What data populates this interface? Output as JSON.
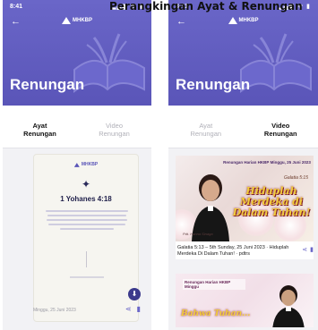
{
  "caption": "Perangkingan Ayat & Renungan",
  "screens": {
    "left": {
      "status": {
        "time": "8:41",
        "icons": "▂▄▆ ᯤ ▮"
      },
      "logo": "MHKBP",
      "title": "Renungan",
      "tabs": [
        "Ayat\nRenungan",
        "Video\nRenungan"
      ],
      "active_tab": 0,
      "verse_card": {
        "logo": "MHKBP",
        "reference": "1 Yohanes 4:18",
        "icon": "star-icon",
        "download_icon": "download-icon"
      },
      "meta": "Minggu, 25 Juni 2023"
    },
    "right": {
      "status": {
        "time": "8:41",
        "icons": "▂▄▆ ᯤ ▮"
      },
      "logo": "MHKBP",
      "title": "Renungan",
      "tabs": [
        "Ayat\nRenungan",
        "Video\nRenungan"
      ],
      "active_tab": 1,
      "videos": [
        {
          "thumb_heading": "Renungan Harian HKBP Minggu, 25 Juni 2023",
          "thumb_tag": "Galatia 5:15",
          "thumb_script": "Hiduplah\nMerdeka di\nDalam Tuhan!",
          "thumb_name": "Pdt. Hanna Sinaga",
          "title": "Galatia 5:13 – 5th Sunday, 25 Juni 2023 · Hiduplah Merdeka Di Dalam Tuhan! · pdtrs"
        },
        {
          "thumb_heading": "Renungan Harian HKBP Minggu",
          "thumb_script": "Bahwa Tuhan..."
        }
      ]
    }
  },
  "colors": {
    "header": "#6a66c8",
    "accent": "#3c3a8c",
    "script": "#f1cc3a"
  }
}
